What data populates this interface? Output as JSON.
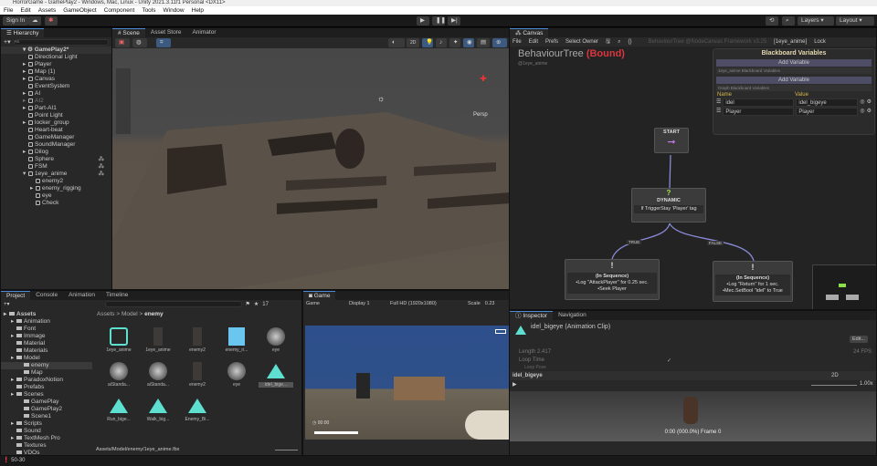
{
  "window": {
    "title": "HorrorGame - GamePlay2 - Windows, Mac, Linux - Unity 2021.3.11f1 Personal <DX11>"
  },
  "menu": [
    "File",
    "Edit",
    "Assets",
    "GameObject",
    "Component",
    "Tools",
    "Window",
    "Help"
  ],
  "toolbar": {
    "sign_in": "Sign In",
    "layers": "Layers",
    "layout": "Layout"
  },
  "hierarchy": {
    "tab": "Hierarchy",
    "search_placeholder": "All",
    "scene": "GamePlay2*",
    "items": [
      {
        "label": "Directional Light",
        "depth": 1,
        "arrow": false
      },
      {
        "label": "Player",
        "depth": 1,
        "arrow": true
      },
      {
        "label": "Map (1)",
        "depth": 1,
        "arrow": true
      },
      {
        "label": "Canvas",
        "depth": 1,
        "arrow": true
      },
      {
        "label": "EventSystem",
        "depth": 1,
        "arrow": false
      },
      {
        "label": "AI",
        "depth": 1,
        "arrow": true
      },
      {
        "label": "AI2",
        "depth": 1,
        "arrow": true,
        "disabled": true
      },
      {
        "label": "Part-AI1",
        "depth": 1,
        "arrow": true
      },
      {
        "label": "Point Light",
        "depth": 1,
        "arrow": false
      },
      {
        "label": "locker_group",
        "depth": 1,
        "arrow": true
      },
      {
        "label": "Heart-beat",
        "depth": 1,
        "arrow": false
      },
      {
        "label": "GameManager",
        "depth": 1,
        "arrow": false
      },
      {
        "label": "SoundManager",
        "depth": 1,
        "arrow": false
      },
      {
        "label": "Dilog",
        "depth": 1,
        "arrow": true
      },
      {
        "label": "Sphere",
        "depth": 1,
        "arrow": false,
        "graph": true
      },
      {
        "label": "FSM",
        "depth": 1,
        "arrow": false,
        "graph": true
      },
      {
        "label": "1eye_anime",
        "depth": 1,
        "arrow": true,
        "open": true,
        "graph": true
      },
      {
        "label": "enemy2",
        "depth": 2,
        "arrow": false
      },
      {
        "label": "enemy_rigging",
        "depth": 2,
        "arrow": true
      },
      {
        "label": "eye",
        "depth": 2,
        "arrow": false
      },
      {
        "label": "Check",
        "depth": 2,
        "arrow": false
      }
    ]
  },
  "scene": {
    "tabs": [
      "Scene",
      "Asset Store",
      "Animator"
    ],
    "persp": "Persp",
    "mode_2d": "2D"
  },
  "canvas": {
    "tab": "Canvas",
    "menu": [
      "File",
      "Edit",
      "Prefs",
      "Select Owner"
    ],
    "framework": "BehaviourTree @NodeCanvas Framework v3.25",
    "owner": "[1eye_anime]",
    "lock": "Lock",
    "title": "BehaviourTree",
    "bound": "(Bound)",
    "subtitle": "@1eye_anime",
    "start": "START",
    "dynamic": {
      "title": "DYNAMIC",
      "condition": "If TriggerStay 'Player' tag"
    },
    "true_label": "TRUE",
    "false_label": "FALSE",
    "left_node": {
      "title": "(In Sequence)",
      "line1": "•Log \"AttackPlayer\" for 0.25 sec.",
      "line2": "•Seek Player"
    },
    "right_node": {
      "title": "(In Sequence)",
      "line1": "•Log \"Return\" for 1 sec.",
      "line2": "•Mec.SetBool \"idel\" to True"
    },
    "blackboard": {
      "title": "Blackboard Variables",
      "add": "Add Variable",
      "section1": "1eye_anime Blackboard Variables",
      "section2": "Graph Blackboard Variables",
      "name_col": "Name",
      "value_col": "Value",
      "vars": [
        {
          "name": "idel",
          "value": "idel_bigeye"
        },
        {
          "name": "Player",
          "value": "Player"
        }
      ]
    },
    "accent": "#d9363e"
  },
  "project": {
    "tabs": [
      "Project",
      "Console",
      "Animation",
      "Timeline"
    ],
    "hidden_count": "17",
    "breadcrumb": [
      "Assets",
      "Model",
      "enemy"
    ],
    "tree": [
      {
        "label": "Assets",
        "depth": 0,
        "arrow": true,
        "bold": true
      },
      {
        "label": "Animation",
        "depth": 1,
        "arrow": true
      },
      {
        "label": "Font",
        "depth": 1
      },
      {
        "label": "Immage",
        "depth": 1,
        "arrow": true
      },
      {
        "label": "Material",
        "depth": 1
      },
      {
        "label": "Materials",
        "depth": 1
      },
      {
        "label": "Model",
        "depth": 1,
        "arrow": true
      },
      {
        "label": "enemy",
        "depth": 2,
        "selected": true
      },
      {
        "label": "Map",
        "depth": 2
      },
      {
        "label": "ParadoxNotion",
        "depth": 1,
        "arrow": true
      },
      {
        "label": "Prefabs",
        "depth": 1
      },
      {
        "label": "Scenes",
        "depth": 1,
        "arrow": true
      },
      {
        "label": "GamePlay",
        "depth": 2
      },
      {
        "label": "GamePlay2",
        "depth": 2
      },
      {
        "label": "Scene1",
        "depth": 2
      },
      {
        "label": "Scripts",
        "depth": 1,
        "arrow": true
      },
      {
        "label": "Sound",
        "depth": 1
      },
      {
        "label": "TextMesh Pro",
        "depth": 1,
        "arrow": true
      },
      {
        "label": "Textures",
        "depth": 1
      },
      {
        "label": "VDOs",
        "depth": 1
      }
    ],
    "assets": [
      "1eye_anime",
      "1eye_anime",
      "enemy2",
      "enemy_ri...",
      "eye",
      "aiStanda...",
      "aiStanda...",
      "enemy2",
      "eye",
      "idel_bige...",
      "Run_bige...",
      "Walk_big...",
      "Enemy_Bi..."
    ],
    "path": "Assets/Model/enemy/1eye_anime.fbx"
  },
  "game": {
    "tab": "Game",
    "mode": "Game",
    "display": "Display 1",
    "resolution": "Full HD (1920x1080)",
    "scale_label": "Scale",
    "scale": "0.23",
    "timer": "00:00"
  },
  "inspector": {
    "tabs": [
      "Inspector",
      "Navigation"
    ],
    "title": "idel_bigeye (Animation Clip)",
    "edit": "Edit...",
    "length_label": "Length",
    "length": "2.417",
    "fps": "24 FPS",
    "loop_time": "Loop Time",
    "loop_pose": "Loop Pose",
    "preview_name": "idel_bigeye",
    "preview_2d": "2D",
    "speed": "1.00x",
    "frame": "0:00 (000.0%) Frame 0"
  },
  "status": {
    "text": "50-30"
  }
}
